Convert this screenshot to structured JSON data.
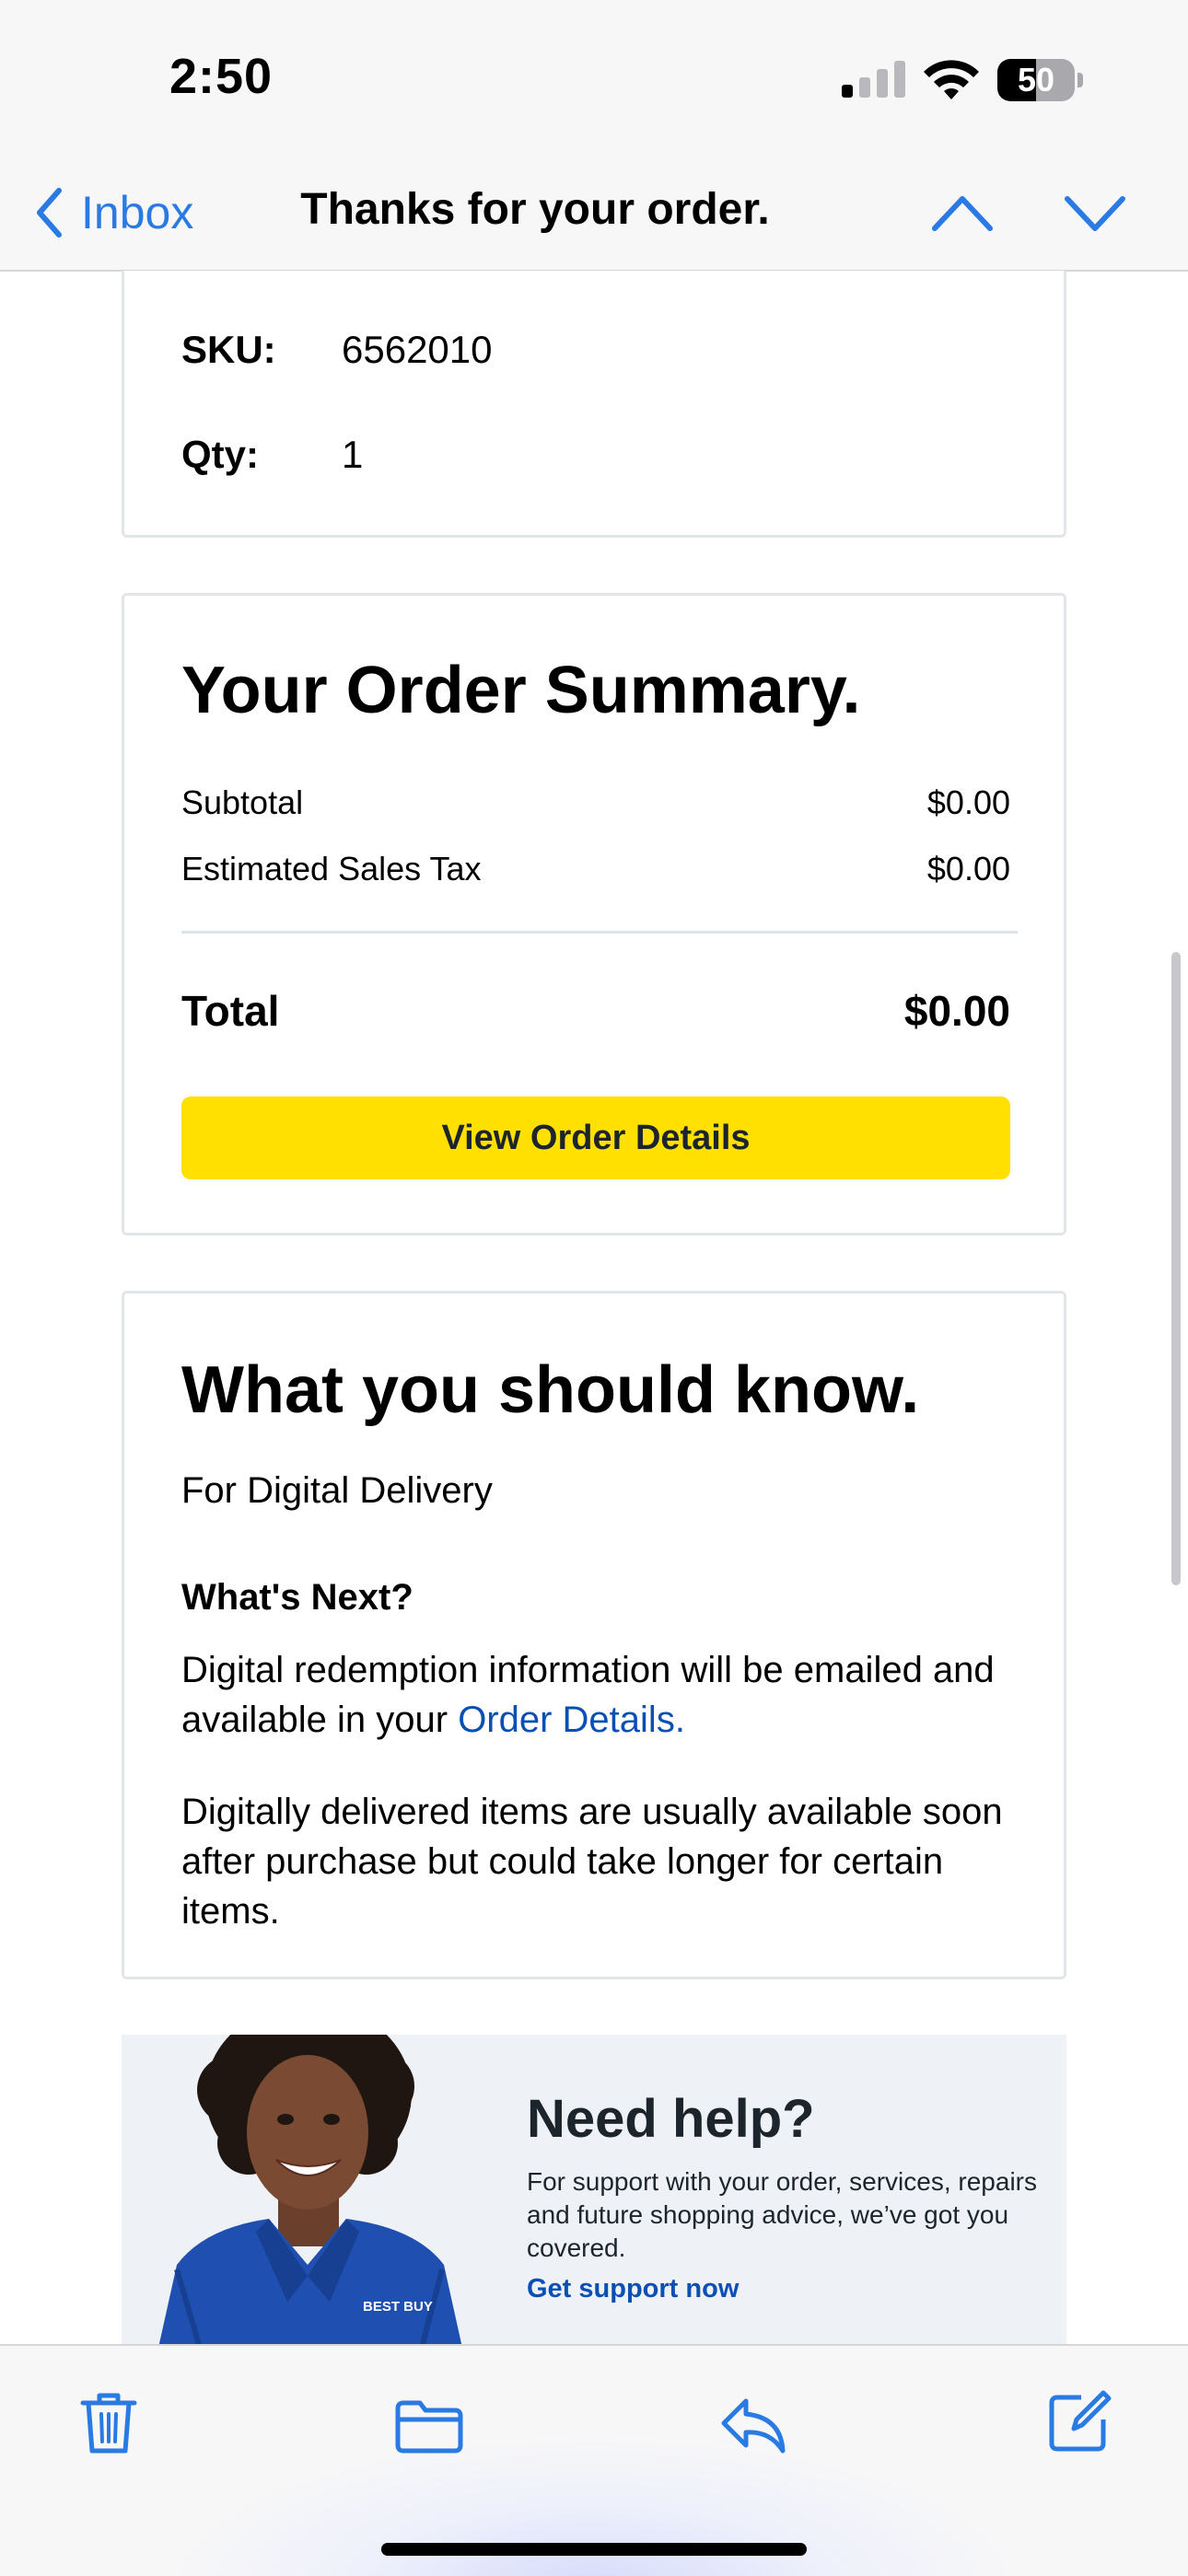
{
  "status": {
    "time": "2:50",
    "battery": "50",
    "battery_level": 0.5
  },
  "nav": {
    "back_label": "Inbox",
    "title": "Thanks for your order."
  },
  "item": {
    "sku_label": "SKU:",
    "sku_value": "6562010",
    "qty_label": "Qty:",
    "qty_value": "1"
  },
  "summary": {
    "title": "Your Order Summary.",
    "subtotal_label": "Subtotal",
    "subtotal_value": "$0.00",
    "tax_label": "Estimated Sales Tax",
    "tax_value": "$0.00",
    "total_label": "Total",
    "total_value": "$0.00",
    "button_label": "View Order Details"
  },
  "know": {
    "title": "What you should know.",
    "subtitle": "For Digital Delivery",
    "next_heading": "What's Next?",
    "para1_text": "Digital redemption information will be emailed and available in your ",
    "para1_link": "Order Details",
    "para1_end": ".",
    "para2": "Digitally delivered items are usually available soon after purchase but could take longer for certain items."
  },
  "help": {
    "title": "Need help?",
    "text": "For support with your order, services, repairs and future shopping advice, we’ve got you covered.",
    "link": "Get support now",
    "shirt_logo": "BEST BUY"
  },
  "toolbar": {
    "items": [
      "trash-icon",
      "folder-icon",
      "reply-icon",
      "compose-icon"
    ]
  },
  "colors": {
    "accent": "#2a7ae4",
    "link": "#0a4fb4",
    "button": "#ffe000",
    "banner": "#eef1f6"
  }
}
